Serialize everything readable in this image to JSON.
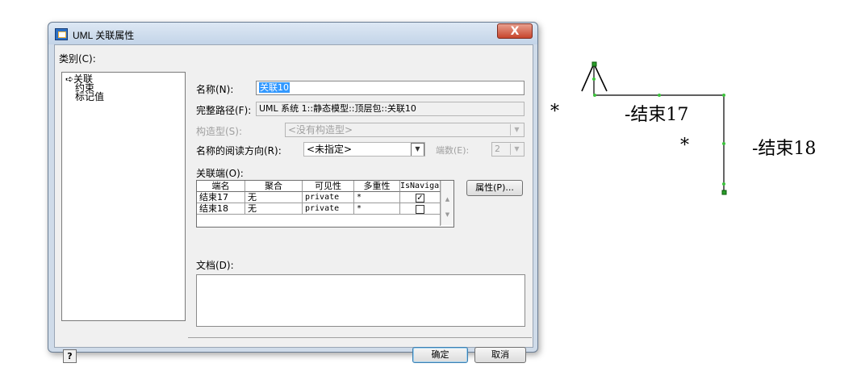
{
  "window": {
    "title": "UML 关联属性",
    "close_glyph": "X"
  },
  "category": {
    "label": "类别(C):",
    "items": [
      "➪关联",
      "约束",
      "标记值"
    ]
  },
  "form": {
    "name_label": "名称(N):",
    "name_value": "关联10",
    "fullpath_label": "完整路径(F):",
    "fullpath_value": "UML 系统 1::静态模型::顶层包::关联10",
    "stereotype_label": "构造型(S):",
    "stereotype_value": "<没有构造型>",
    "reading_dir_label": "名称的阅读方向(R):",
    "reading_dir_value": "<未指定>",
    "ends_count_label": "端数(E):",
    "ends_count_value": "2",
    "ends_label": "关联端(O):",
    "properties_button": "属性(P)...",
    "doc_label": "文档(D):"
  },
  "ends_table": {
    "headers": [
      "端名",
      "聚合",
      "可见性",
      "多重性",
      "IsNavigabl"
    ],
    "rows": [
      {
        "name": "结束17",
        "aggregation": "无",
        "visibility": "private",
        "multiplicity": "*",
        "navigable": "✓"
      },
      {
        "name": "结束18",
        "aggregation": "无",
        "visibility": "private",
        "multiplicity": "*",
        "navigable": ""
      }
    ]
  },
  "buttons": {
    "help": "?",
    "ok": "确定",
    "cancel": "取消"
  },
  "diagram": {
    "end17_multiplicity": "*",
    "end17_label": "-结束17",
    "end18_multiplicity": "*",
    "end18_label": "-结束18"
  }
}
